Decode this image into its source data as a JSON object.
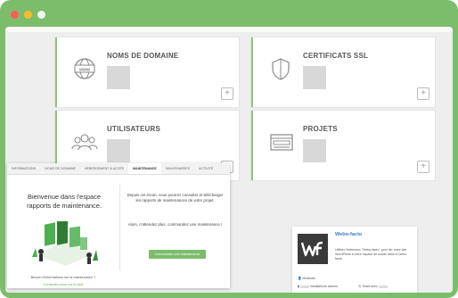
{
  "cards": [
    {
      "title": "NOMS DE DOMAINE",
      "icon": "www-globe-icon"
    },
    {
      "title": "CERTIFICATS SSL",
      "icon": "shield-icon"
    },
    {
      "title": "UTILISATEURS",
      "icon": "users-icon"
    },
    {
      "title": "PROJETS",
      "icon": "window-icon"
    }
  ],
  "plus_label": "+",
  "tabs": [
    "INFORMATIONS",
    "NOMS DE DOMAINE",
    "HÉBERGEMENT & ACCÈS",
    "MAINTENANCE",
    "SAUVEGARDES",
    "ACTIVITÉ"
  ],
  "active_tab": "MAINTENANCE",
  "maintenance": {
    "welcome": "Bienvenue dans l'espace rapports de maintenance.",
    "need_info": "Besoin d'informations sur la maintenance ?",
    "contact_link": "Contactez-nous via le chat",
    "desc": "Depuis cet écran, vous pourrez consulter et télécharger les rapports de maintenances de votre projet.",
    "cta_text": "Alors, n'attendez plus, commandez une maintenance !",
    "order_button": "Commander une maintenance"
  },
  "plugin": {
    "name": "Webo-facto",
    "description": "Utiliser l'extension \"Webo-facto\" pour lier votre site WordPress à votre espace de travail dans le webo-facto.",
    "author_label": "Modicale",
    "installs_label": "installations actives",
    "tested_label": "Testé avec"
  },
  "colors": {
    "frame": "#7cbd6b",
    "accent": "#7cbd6b",
    "link": "#3a79c4"
  }
}
